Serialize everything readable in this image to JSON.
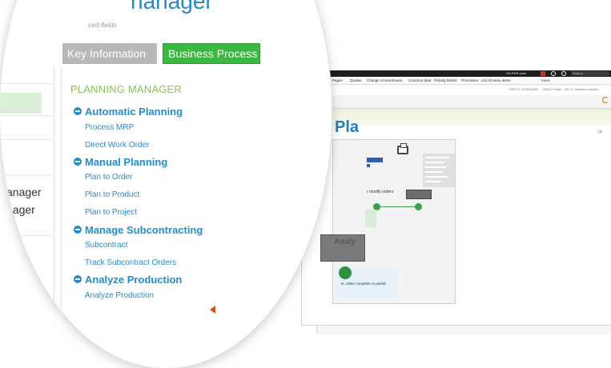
{
  "background_app": {
    "user_label": "US-PDR User",
    "search_placeholder": "Search",
    "menu_items": [
      "Pages",
      "Quotes",
      "Change of warehouse",
      "Common data",
      "Picking tickets",
      "Processes",
      "List of menu items",
      "more.."
    ],
    "crumbs": [
      "ERP 01 STANDARD",
      "SEED Folder - US V7 Installed solution"
    ],
    "panel_heading": "Pla",
    "modify_orders_text": "r modify orders",
    "analyze_text": "Analy",
    "note_text": "ts, either complete or partial"
  },
  "header": {
    "title": "nanager",
    "subtitle": "ced fields"
  },
  "tabs": [
    {
      "label": "Key Information",
      "active": false
    },
    {
      "label": "Business Process",
      "active": true
    }
  ],
  "left_nav": {
    "items": [
      "anager",
      "nager"
    ]
  },
  "planning": {
    "title": "PLANNING MANAGER",
    "sections": [
      {
        "label": "Automatic Planning",
        "links": [
          "Process MRP",
          "Direct Work Order"
        ]
      },
      {
        "label": "Manual Planning",
        "links": [
          "Plan to Order",
          "Plan to Product",
          "Plan to Project"
        ]
      },
      {
        "label": "Manage Subcontracting",
        "links": [
          "Subcontract",
          "Track Subcontract Orders"
        ]
      },
      {
        "label": "Analyze Production",
        "links": [
          "Analyze Production"
        ]
      }
    ]
  },
  "colors": {
    "accent_blue": "#1f8fd0",
    "green_tab": "#3cb742",
    "grey_tab": "#b8b8b8",
    "title_green": "#8bc34a",
    "arrow_orange": "#e04b1a"
  }
}
